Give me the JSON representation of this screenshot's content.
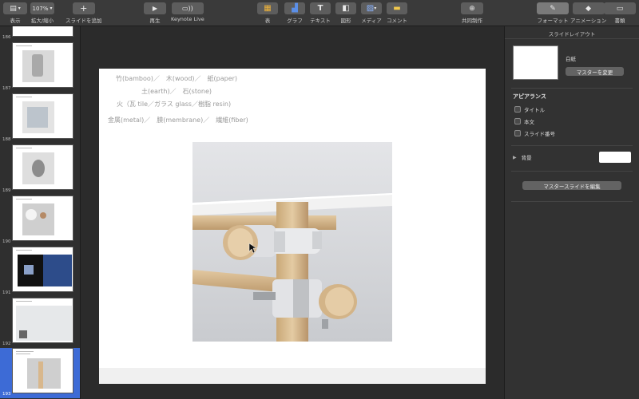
{
  "toolbar": {
    "view": "表示",
    "zoom_value": "107%",
    "zoom": "拡大/縮小",
    "add_slide": "スライドを追加",
    "play": "再生",
    "keynote_live": "Keynote Live",
    "table": "表",
    "chart": "グラフ",
    "text": "テキスト",
    "shape": "図形",
    "media": "メディア",
    "comment": "コメント",
    "collaborate": "共同制作",
    "format": "フォーマット",
    "animate": "アニメーション",
    "document": "書類"
  },
  "slides": [
    {
      "num": "186"
    },
    {
      "num": "187"
    },
    {
      "num": "188"
    },
    {
      "num": "189"
    },
    {
      "num": "190"
    },
    {
      "num": "191"
    },
    {
      "num": "192"
    },
    {
      "num": "193"
    }
  ],
  "slide": {
    "line1": "竹(bamboo)／　木(wood)／　紙(paper)",
    "line2": "土(earth)／　石(stone)",
    "line3": "火（瓦 tile／ガラス glass／樹脂 resin)",
    "line4": "金属(metal)／　膜(membrane)／　繊維(fiber)"
  },
  "inspector": {
    "title": "スライドレイアウト",
    "master_name": "白紙",
    "change_master": "マスターを変更",
    "appearance": "アピアランス",
    "title_check": "タイトル",
    "body_check": "本文",
    "slide_number_check": "スライド番号",
    "background": "背景",
    "edit_master": "マスタースライドを編集"
  },
  "colors": {
    "selected": "#3d6bd6",
    "toolbar_bg": "#3a3a3a",
    "panel_bg": "#323232"
  }
}
